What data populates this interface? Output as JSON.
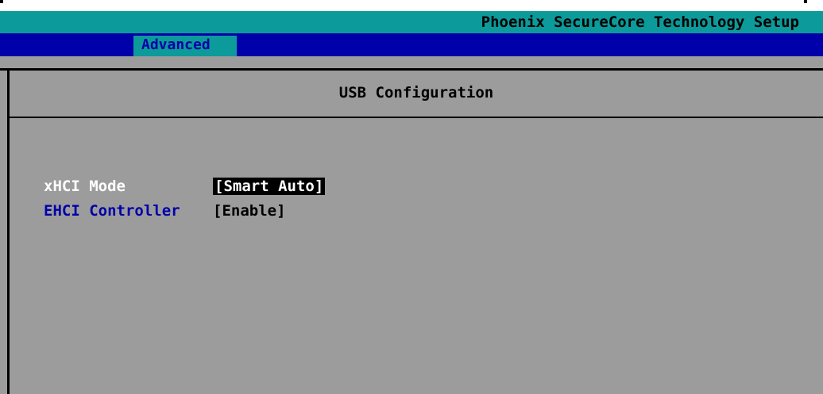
{
  "header": {
    "title": "Phoenix SecureCore Technology Setup"
  },
  "menu": {
    "active_tab": "Advanced"
  },
  "page": {
    "title": "USB Configuration"
  },
  "settings": [
    {
      "label": "xHCI Mode",
      "value": "[Smart Auto]",
      "selected": true
    },
    {
      "label": "EHCI Controller",
      "value": "[Enable]",
      "selected": false
    }
  ],
  "colors": {
    "background": "#9c9c9c",
    "title_bar": "#0d9a9a",
    "menu_bar": "#0000aa",
    "selected_label": "#ffffff",
    "normal_label": "#0000aa"
  }
}
